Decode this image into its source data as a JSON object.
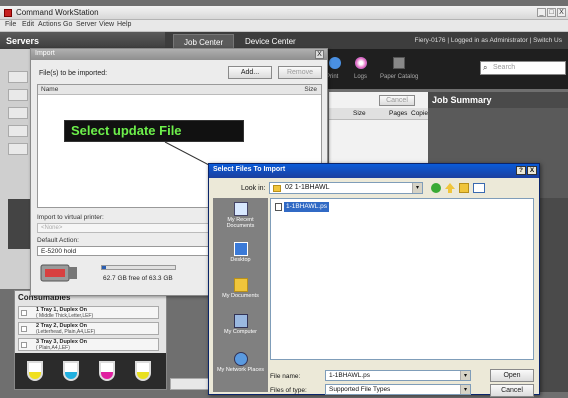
{
  "window": {
    "title": "Command WorkStation",
    "min": "_",
    "max": "□",
    "close": "X"
  },
  "menubar": [
    "File",
    "Edit",
    "Actions",
    "Go",
    "Server",
    "View",
    "Help"
  ],
  "servers": {
    "label": "Servers"
  },
  "tabs": [
    {
      "label": "Job Center"
    },
    {
      "label": "Device Center"
    }
  ],
  "login_status": "Fiery-0176 | Logged in as Administrator | Switch Us",
  "toolbar": {
    "items": [
      {
        "label": "Print"
      },
      {
        "label": "Logs"
      },
      {
        "label": "Paper Catalog"
      }
    ],
    "search_placeholder": "Search",
    "cancel_label": "Cancel"
  },
  "job_list": {
    "headers": [
      "Size",
      "Pages",
      "Copie"
    ]
  },
  "job_summary": {
    "title": "Job Summary"
  },
  "import_dialog": {
    "title": "Import",
    "close": "X",
    "files_label": "File(s) to be imported:",
    "add_label": "Add...",
    "remove_label": "Remove",
    "col_name": "Name",
    "col_size": "Size",
    "virtual_printer_label": "Import to virtual printer:",
    "virtual_printer_value": "<None>",
    "default_action_label": "Default Action:",
    "default_action_value": "E-5200 hold",
    "disk_text": "62.7 GB free of 63.3 GB",
    "disk_used_fraction": 0.05
  },
  "callout": {
    "text": "Select update File"
  },
  "consumables": {
    "title": "Consumables",
    "trays": [
      {
        "line1": "1  Tray 1, Duplex On",
        "line2": "( Middle Thick,Letter,LEF)"
      },
      {
        "line1": "2  Tray 2, Duplex On",
        "line2": "(Letterhead, Plain,A4,LEF)"
      },
      {
        "line1": "3  Tray 3, Duplex On",
        "line2": "( Plain,A4,LEF)"
      }
    ],
    "toner_colors": [
      "#f0e020",
      "#20b0e0",
      "#e020a0",
      "#e8e020"
    ]
  },
  "select_dialog": {
    "title": "Select Files To Import",
    "help": "?",
    "close": "X",
    "look_in_label": "Look in:",
    "look_in_value": "02 1-1BHAWL",
    "dropdown_arrow": "▾",
    "places": [
      {
        "label": "My Recent Documents"
      },
      {
        "label": "Desktop"
      },
      {
        "label": "My Documents"
      },
      {
        "label": "My Computer"
      },
      {
        "label": "My Network Places"
      }
    ],
    "file_item": "1-1BHAWL.ps",
    "file_name_label": "File name:",
    "file_name_value": "1-1BHAWL.ps",
    "file_type_label": "Files of type:",
    "file_type_value": "Supported File Types",
    "open_label": "Open",
    "cancel_label": "Cancel"
  }
}
